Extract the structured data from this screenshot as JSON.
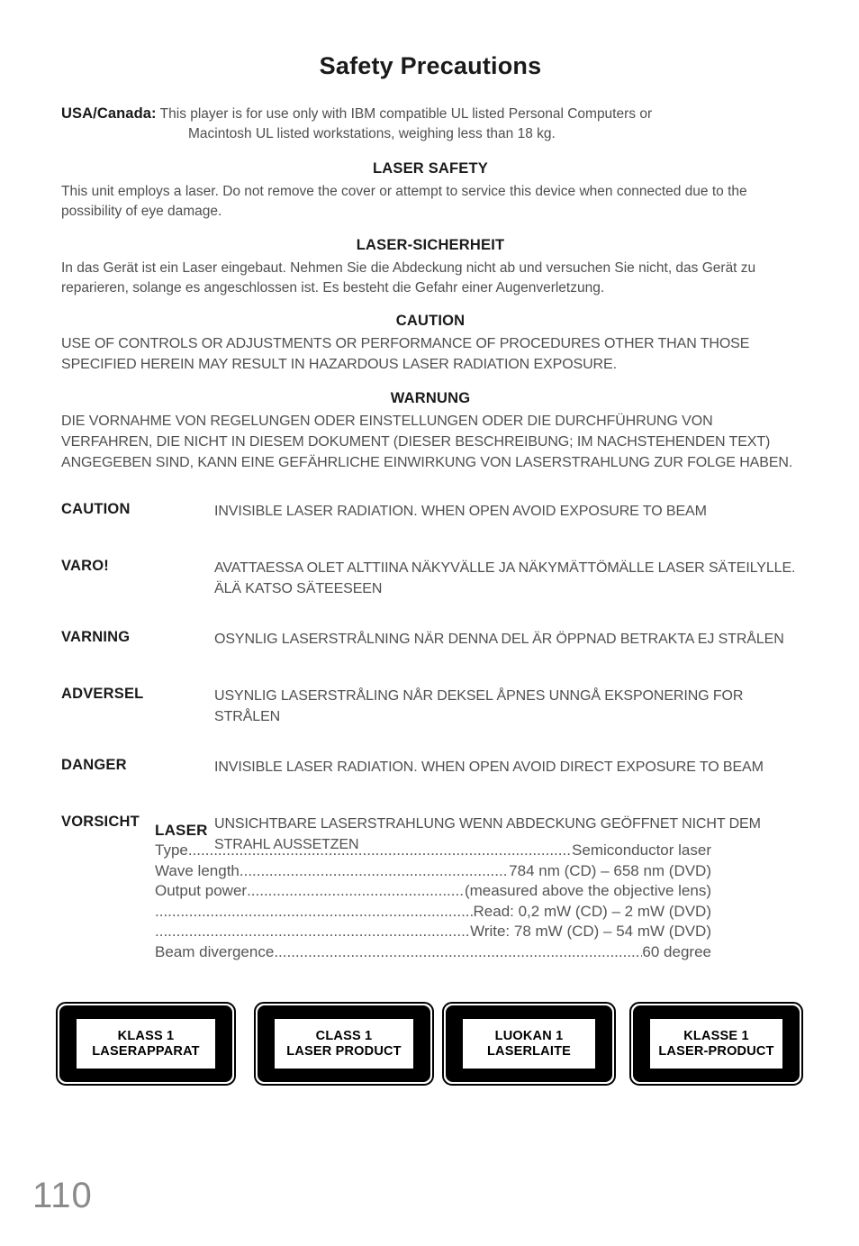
{
  "page": {
    "title": "Safety Precautions",
    "page_number": "110"
  },
  "usa_canada": {
    "label": "USA/Canada:",
    "line1": "This player is for use only with IBM compatible UL listed Personal Computers or",
    "line2": "Macintosh UL listed workstations, weighing less than 18 kg."
  },
  "sections": [
    {
      "heading": "LASER SAFETY",
      "body": "This unit employs a laser. Do not remove the cover or attempt to service this device when connected due to the possibility of eye damage."
    },
    {
      "heading": "LASER-SICHERHEIT",
      "body": "In das Gerät ist ein Laser eingebaut. Nehmen Sie die Abdeckung nicht ab und versuchen Sie nicht, das Gerät zu reparieren, solange es angeschlossen ist. Es besteht die Gefahr einer Augenverletzung."
    },
    {
      "heading": "CAUTION",
      "body": "USE OF CONTROLS OR ADJUSTMENTS OR PERFORMANCE OF PROCEDURES OTHER THAN THOSE SPECIFIED HEREIN MAY RESULT IN HAZARDOUS LASER RADIATION EXPOSURE."
    },
    {
      "heading": "WARNUNG",
      "body": "DIE VORNAHME VON REGELUNGEN ODER EINSTELLUNGEN ODER DIE DURCHFÜHRUNG VON VERFAHREN, DIE NICHT IN DIESEM DOKUMENT (DIESER BESCHREIBUNG; IM NACHSTEHENDEN TEXT) ANGEGEBEN SIND, KANN EINE GEFÄHRLICHE EINWIRKUNG VON LASERSTRAHLUNG ZUR FOLGE HABEN."
    }
  ],
  "warnings": [
    {
      "term": "CAUTION",
      "desc": "INVISIBLE LASER RADIATION. WHEN OPEN AVOID EXPOSURE TO BEAM"
    },
    {
      "term": "VARO!",
      "desc": "AVATTAESSA OLET ALTTIINA NÄKYVÄLLE JA NÄKYMÄTTÖMÄLLE LASER SÄTEILYLLE. ÄLÄ KATSO SÄTEESEEN"
    },
    {
      "term": "VARNING",
      "desc": "OSYNLIG LASERSTRÅLNING NÄR DENNA DEL ÄR ÖPPNAD BETRAKTA EJ STRÅLEN"
    },
    {
      "term": "ADVERSEL",
      "desc": "USYNLIG LASERSTRÅLING NÅR DEKSEL ÅPNES UNNGÅ EKSPONERING FOR STRÅLEN"
    },
    {
      "term": "DANGER",
      "desc": "INVISIBLE LASER RADIATION. WHEN OPEN AVOID DIRECT EXPOSURE TO BEAM"
    },
    {
      "term": "VORSICHT",
      "desc": "UNSICHTBARE LASERSTRAHLUNG WENN ABDECKUNG GEÖFFNET NICHT DEM STRAHL AUSSETZEN"
    }
  ],
  "laser_spec": {
    "title": "LASER",
    "rows": [
      {
        "key": "Type",
        "value": "Semiconductor laser"
      },
      {
        "key": "Wave length ",
        "value": "784 nm (CD) – 658 nm (DVD)"
      },
      {
        "key": "Output power",
        "value": "(measured above the objective lens)"
      },
      {
        "key": "",
        "value": "Read: 0,2 mW (CD) – 2 mW (DVD)"
      },
      {
        "key": "",
        "value": "Write: 78 mW (CD) – 54 mW (DVD)"
      },
      {
        "key": "Beam divergence",
        "value": "60 degree"
      }
    ]
  },
  "class_labels": [
    {
      "line1": "KLASS 1",
      "line2": "LASERAPPARAT"
    },
    {
      "line1": "CLASS 1",
      "line2": "LASER PRODUCT"
    },
    {
      "line1": "LUOKAN 1",
      "line2": "LASERLAITE"
    },
    {
      "line1": "KLASSE 1",
      "line2": "LASER-PRODUCT"
    }
  ]
}
